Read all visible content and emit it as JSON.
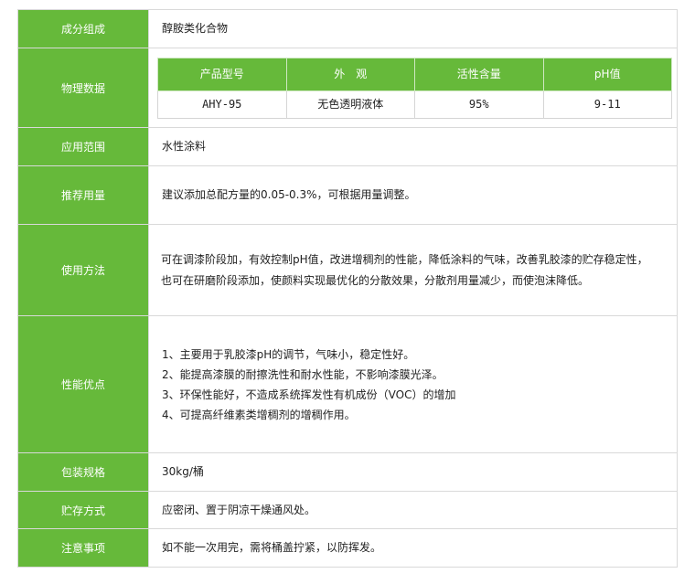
{
  "rows": {
    "composition": {
      "label": "成分组成",
      "value": "醇胺类化合物"
    },
    "physical": {
      "label": "物理数据",
      "headers": [
        "产品型号",
        "外　观",
        "活性含量",
        "pH值"
      ],
      "cells": [
        "AHY-95",
        "无色透明液体",
        "95%",
        "9-11"
      ]
    },
    "application": {
      "label": "应用范围",
      "value": "水性涂料"
    },
    "dosage": {
      "label": "推荐用量",
      "value": "建议添加总配方量的0.05-0.3%，可根据用量调整。"
    },
    "usage": {
      "label": "使用方法",
      "lines": [
        "可在调漆阶段加，有效控制pH值，改进增稠剂的性能，降低涂料的气味，改善乳胶漆的贮存稳定性，",
        "也可在研磨阶段添加，使颜料实现最优化的分散效果，分散剂用量减少，而使泡沫降低。"
      ]
    },
    "advantages": {
      "label": "性能优点",
      "items": [
        "1、主要用于乳胶漆pH的调节，气味小，稳定性好。",
        "2、能提高漆膜的耐擦洗性和耐水性能，不影响漆膜光泽。",
        "3、环保性能好，不造成系统挥发性有机成份（VOC）的增加",
        "4、可提高纤维素类增稠剂的增稠作用。"
      ]
    },
    "packaging": {
      "label": "包装规格",
      "value": "30kg/桶"
    },
    "storage": {
      "label": "贮存方式",
      "value": "应密闭、置于阴凉干燥通风处。"
    },
    "notes": {
      "label": "注意事项",
      "value": "如不能一次用完，需将桶盖拧紧，以防挥发。"
    }
  },
  "colors": {
    "label_bg": "#66b93a",
    "label_text": "#ffffff",
    "border": "#d9d9d9"
  }
}
